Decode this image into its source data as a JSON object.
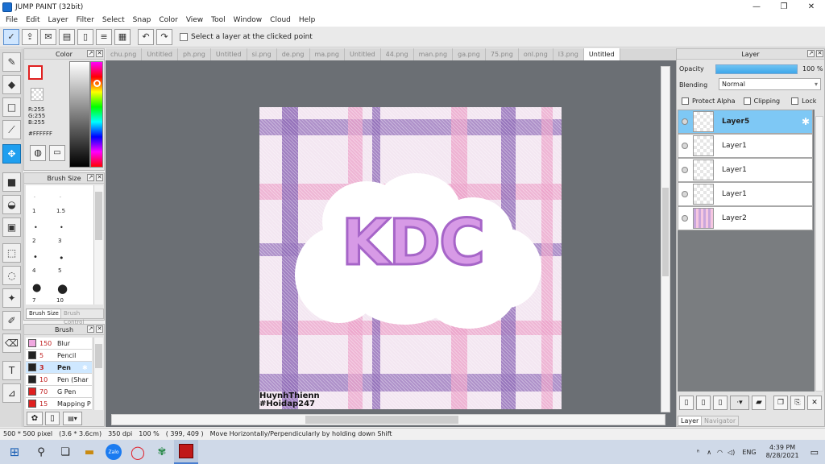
{
  "window": {
    "title": "JUMP PAINT (32bit)",
    "min": "—",
    "max": "❐",
    "close": "✕"
  },
  "menu": [
    "File",
    "Edit",
    "Layer",
    "Filter",
    "Select",
    "Snap",
    "Color",
    "View",
    "Tool",
    "Window",
    "Cloud",
    "Help"
  ],
  "toolbar": {
    "select_layer_label": "Select a layer at the clicked point"
  },
  "tabs": [
    "chu.png",
    "Untitled",
    "ph.png",
    "Untitled",
    "si.png",
    "de.png",
    "ma.png",
    "Untitled",
    "44.png",
    "man.png",
    "ga.png",
    "75.png",
    "onl.png",
    "l3.png",
    "Untitled"
  ],
  "color_panel": {
    "title": "Color",
    "r": "R:255",
    "g": "G:255",
    "b": "B:255",
    "hex": "#FFFFFF"
  },
  "brush_size_panel": {
    "title": "Brush Size",
    "sizes": [
      "1",
      "1.5",
      "2",
      "3",
      "4",
      "5",
      "7",
      "10"
    ],
    "tab_active": "Brush Size",
    "tab_inactive": "Brush Control"
  },
  "brush_panel": {
    "title": "Brush",
    "items": [
      {
        "size": "150",
        "name": "Blur",
        "color": "#f0a8e0"
      },
      {
        "size": "5",
        "name": "Pencil",
        "color": "#222222"
      },
      {
        "size": "3",
        "name": "Pen",
        "color": "#222222"
      },
      {
        "size": "10",
        "name": "Pen (Shar",
        "color": "#222222"
      },
      {
        "size": "70",
        "name": "G Pen",
        "color": "#e02020"
      },
      {
        "size": "15",
        "name": "Mapping P",
        "color": "#e02020"
      }
    ]
  },
  "canvas": {
    "text": "KDC",
    "signature_line1": "HuynhThienn",
    "signature_line2": "#Hoidap247"
  },
  "layer_panel": {
    "title": "Layer",
    "opacity_label": "Opacity",
    "opacity_value": "100 %",
    "opacity_fraction": 1.0,
    "blending_label": "Blending",
    "blending_value": "Normal",
    "protect_alpha": "Protect Alpha",
    "clipping": "Clipping",
    "lock": "Lock",
    "layers": [
      {
        "name": "Layer5",
        "selected": true
      },
      {
        "name": "Layer1"
      },
      {
        "name": "Layer1"
      },
      {
        "name": "Layer1"
      },
      {
        "name": "Layer2"
      }
    ],
    "tab_layer": "Layer",
    "tab_navigator": "Navigator"
  },
  "status": {
    "size": "500 * 500 pixel",
    "physical": "(3.6 * 3.6cm)",
    "dpi": "350 dpi",
    "zoom": "100 %",
    "coords": "( 399, 409 )",
    "hint": "Move Horizontally/Perpendicularly by holding down Shift"
  },
  "taskbar": {
    "lang": "ENG",
    "time": "4:39 PM",
    "date": "8/28/2021",
    "zalo": "Zalo"
  }
}
